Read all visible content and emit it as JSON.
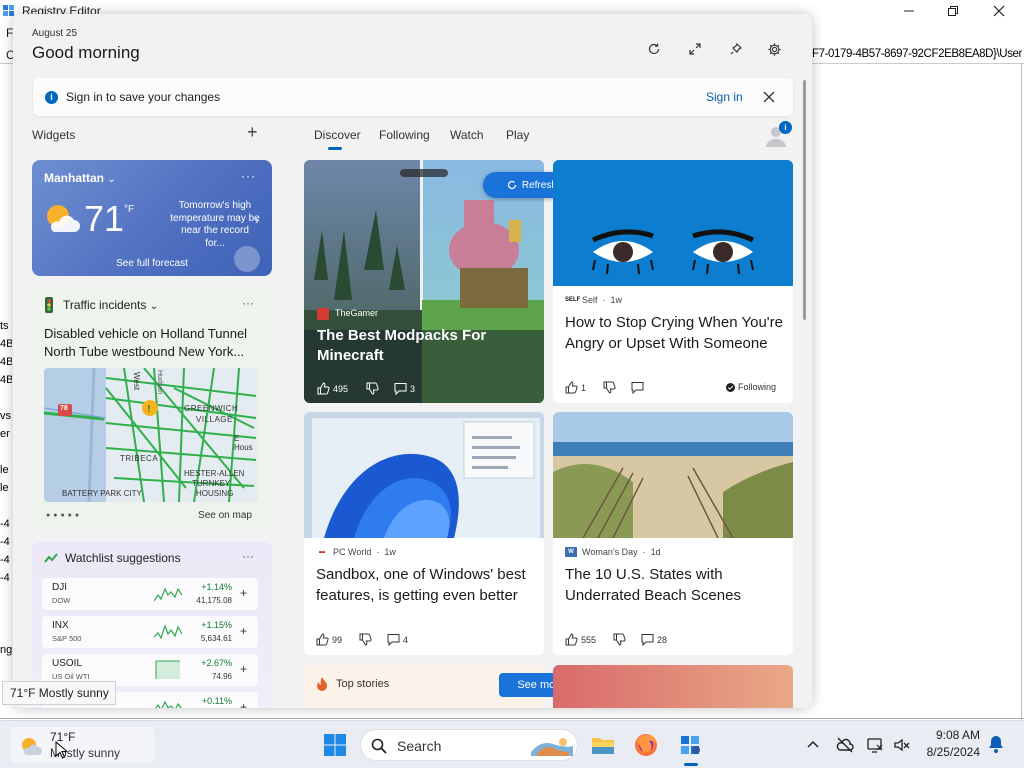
{
  "registry": {
    "title": "Registry Editor",
    "menu_fragment": "F",
    "addr_fragment_left": "C",
    "addr_fragment_right": "F7-0179-4B57-8697-92CF2EB8EA8D}\\User",
    "tree_fragments": [
      "ts",
      "4B",
      "4B",
      "4B",
      "vs",
      "er",
      "le",
      "le",
      "-4",
      "-4",
      "-4",
      "-4",
      "ng"
    ]
  },
  "panel": {
    "date": "August 25",
    "greeting": "Good morning",
    "signin_text": "Sign in to save your changes",
    "signin_link": "Sign in",
    "widgets_label": "Widgets",
    "tabs": [
      "Discover",
      "Following",
      "Watch",
      "Play"
    ],
    "profile_badge": "i"
  },
  "weather": {
    "location": "Manhattan",
    "temp": "71",
    "unit": "°F",
    "note": "Tomorrow's high temperature may be near the record for...",
    "forecast_link": "See full forecast",
    "more": "···"
  },
  "traffic": {
    "title": "Traffic incidents",
    "description": "Disabled vehicle on Holland Tunnel North Tube westbound New York...",
    "see_map": "See on map",
    "more": "···",
    "map_labels": [
      "West",
      "Hudson",
      "GREENWICH",
      "VILLAGE",
      "TRIBECA",
      "E Hous",
      "HESTER-ALLEN",
      "TURNKEY",
      "HOUSING",
      "BATTERY PARK CITY"
    ],
    "highway_shield": "78"
  },
  "watchlist": {
    "title": "Watchlist suggestions",
    "more": "···",
    "stocks": [
      {
        "symbol": "DJI",
        "name": "DOW",
        "change": "+1.14%",
        "value": "41,175.08"
      },
      {
        "symbol": "INX",
        "name": "S&P 500",
        "change": "+1.15%",
        "value": "5,634.61"
      },
      {
        "symbol": "USOIL",
        "name": "US Oil WTI",
        "change": "+2.67%",
        "value": "74.96"
      },
      {
        "symbol": "",
        "name": "",
        "change": "+0.11%",
        "value": ""
      }
    ]
  },
  "feed": {
    "refresh": "Refresh stories",
    "card1": {
      "source": "TheGamer",
      "title": "The Best Modpacks For Minecraft",
      "likes": "495",
      "comments": "3"
    },
    "card2": {
      "source": "Self",
      "age": "1w",
      "title": "How to Stop Crying When You're Angry or Upset With Someone",
      "likes": "1",
      "following": "Following"
    },
    "card3": {
      "source": "PC World",
      "age": "1w",
      "title": "Sandbox, one of Windows' best features, is getting even better",
      "likes": "99",
      "comments": "4"
    },
    "card4": {
      "source": "Woman's Day",
      "age": "1d",
      "title": "The 10 U.S. States with Underrated Beach Scenes",
      "likes": "555",
      "comments": "28"
    },
    "card5": {
      "title": "Top stories"
    },
    "see_more": "See more"
  },
  "tooltip": "71°F Mostly sunny",
  "taskbar": {
    "temp": "71°F",
    "condition": "Mostly sunny",
    "search_placeholder": "Search",
    "time": "9:08 AM",
    "date": "8/25/2024",
    "apps": [
      "file-explorer",
      "firefox",
      "registry-editor"
    ]
  },
  "colors": {
    "accent": "#0067c0",
    "weather_card": "#5576c6",
    "positive": "#117a2e"
  }
}
